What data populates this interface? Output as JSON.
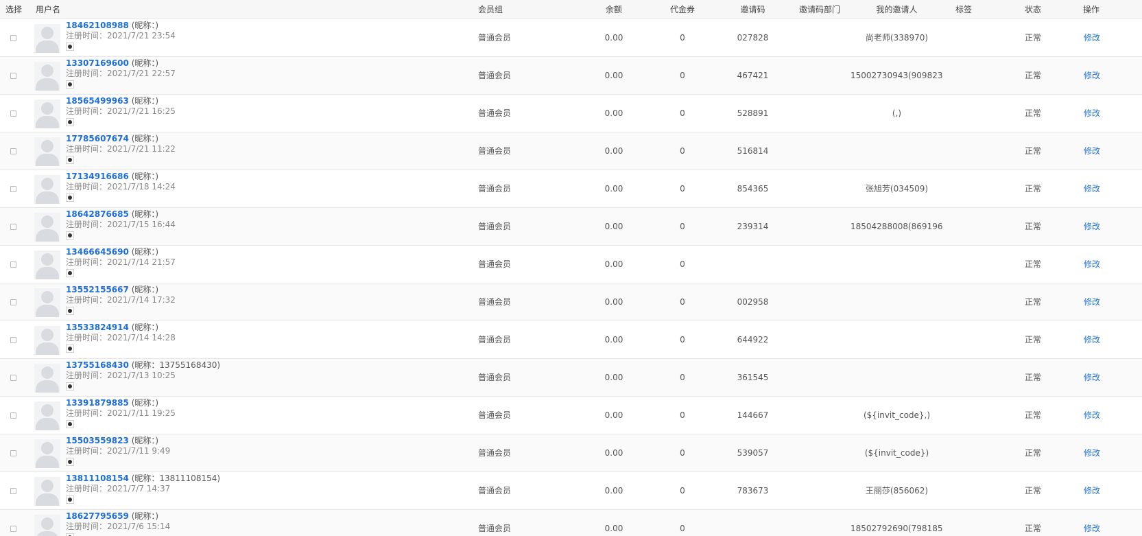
{
  "header": {
    "select": "选择",
    "username": "用户名",
    "group": "会员组",
    "balance": "余额",
    "voucher": "代金券",
    "invite_code": "邀请码",
    "invite_dept": "邀请码部门",
    "my_inviter": "我的邀请人",
    "tag": "标签",
    "status": "状态",
    "action": "操作"
  },
  "labels": {
    "nickname_prefix": "(昵称：",
    "nickname_suffix": ")",
    "reg_prefix": "注册时间：",
    "edit": "修改"
  },
  "icons": {
    "avatar": "default-avatar-icon",
    "badge": "member-badge-icon",
    "checkbox": "checkbox"
  },
  "colors": {
    "link": "#1e6fd9",
    "header_bg": "#f7f7f7",
    "row_alt_bg": "#fafafa"
  },
  "rows": [
    {
      "phone": "18462108988",
      "nickname": "",
      "reg_time": "2021/7/21 23:54",
      "group": "普通会员",
      "balance": "0.00",
      "voucher": "0",
      "invite_code": "027828",
      "invite_dept": "",
      "inviter": "尚老师(338970)",
      "tag": "",
      "status": "正常"
    },
    {
      "phone": "13307169600",
      "nickname": "",
      "reg_time": "2021/7/21 22:57",
      "group": "普通会员",
      "balance": "0.00",
      "voucher": "0",
      "invite_code": "467421",
      "invite_dept": "",
      "inviter": "15002730943(909823)",
      "tag": "",
      "status": "正常"
    },
    {
      "phone": "18565499963",
      "nickname": "",
      "reg_time": "2021/7/21 16:25",
      "group": "普通会员",
      "balance": "0.00",
      "voucher": "0",
      "invite_code": "528891",
      "invite_dept": "",
      "inviter": "(,)",
      "tag": "",
      "status": "正常"
    },
    {
      "phone": "17785607674",
      "nickname": "",
      "reg_time": "2021/7/21 11:22",
      "group": "普通会员",
      "balance": "0.00",
      "voucher": "0",
      "invite_code": "516814",
      "invite_dept": "",
      "inviter": "",
      "tag": "",
      "status": "正常"
    },
    {
      "phone": "17134916686",
      "nickname": "",
      "reg_time": "2021/7/18 14:24",
      "group": "普通会员",
      "balance": "0.00",
      "voucher": "0",
      "invite_code": "854365",
      "invite_dept": "",
      "inviter": "张旭芳(034509)",
      "tag": "",
      "status": "正常"
    },
    {
      "phone": "18642876685",
      "nickname": "",
      "reg_time": "2021/7/15 16:44",
      "group": "普通会员",
      "balance": "0.00",
      "voucher": "0",
      "invite_code": "239314",
      "invite_dept": "",
      "inviter": "18504288008(869196)",
      "tag": "",
      "status": "正常"
    },
    {
      "phone": "13466645690",
      "nickname": "",
      "reg_time": "2021/7/14 21:57",
      "group": "普通会员",
      "balance": "0.00",
      "voucher": "0",
      "invite_code": "",
      "invite_dept": "",
      "inviter": "",
      "tag": "",
      "status": "正常"
    },
    {
      "phone": "13552155667",
      "nickname": "",
      "reg_time": "2021/7/14 17:32",
      "group": "普通会员",
      "balance": "0.00",
      "voucher": "0",
      "invite_code": "002958",
      "invite_dept": "",
      "inviter": "",
      "tag": "",
      "status": "正常"
    },
    {
      "phone": "13533824914",
      "nickname": "",
      "reg_time": "2021/7/14 14:28",
      "group": "普通会员",
      "balance": "0.00",
      "voucher": "0",
      "invite_code": "644922",
      "invite_dept": "",
      "inviter": "",
      "tag": "",
      "status": "正常"
    },
    {
      "phone": "13755168430",
      "nickname": "13755168430",
      "reg_time": "2021/7/13 10:25",
      "group": "普通会员",
      "balance": "0.00",
      "voucher": "0",
      "invite_code": "361545",
      "invite_dept": "",
      "inviter": "",
      "tag": "",
      "status": "正常"
    },
    {
      "phone": "13391879885",
      "nickname": "",
      "reg_time": "2021/7/11 19:25",
      "group": "普通会员",
      "balance": "0.00",
      "voucher": "0",
      "invite_code": "144667",
      "invite_dept": "",
      "inviter": "(${invit_code},)",
      "tag": "",
      "status": "正常"
    },
    {
      "phone": "15503559823",
      "nickname": "",
      "reg_time": "2021/7/11 9:49",
      "group": "普通会员",
      "balance": "0.00",
      "voucher": "0",
      "invite_code": "539057",
      "invite_dept": "",
      "inviter": "(${invit_code})",
      "tag": "",
      "status": "正常"
    },
    {
      "phone": "13811108154",
      "nickname": "13811108154",
      "reg_time": "2021/7/7 14:37",
      "group": "普通会员",
      "balance": "0.00",
      "voucher": "0",
      "invite_code": "783673",
      "invite_dept": "",
      "inviter": "王丽莎(856062)",
      "tag": "",
      "status": "正常"
    },
    {
      "phone": "18627795659",
      "nickname": "",
      "reg_time": "2021/7/6 15:14",
      "group": "普通会员",
      "balance": "0.00",
      "voucher": "0",
      "invite_code": "",
      "invite_dept": "",
      "inviter": "18502792690(798185)",
      "tag": "",
      "status": "正常"
    }
  ]
}
